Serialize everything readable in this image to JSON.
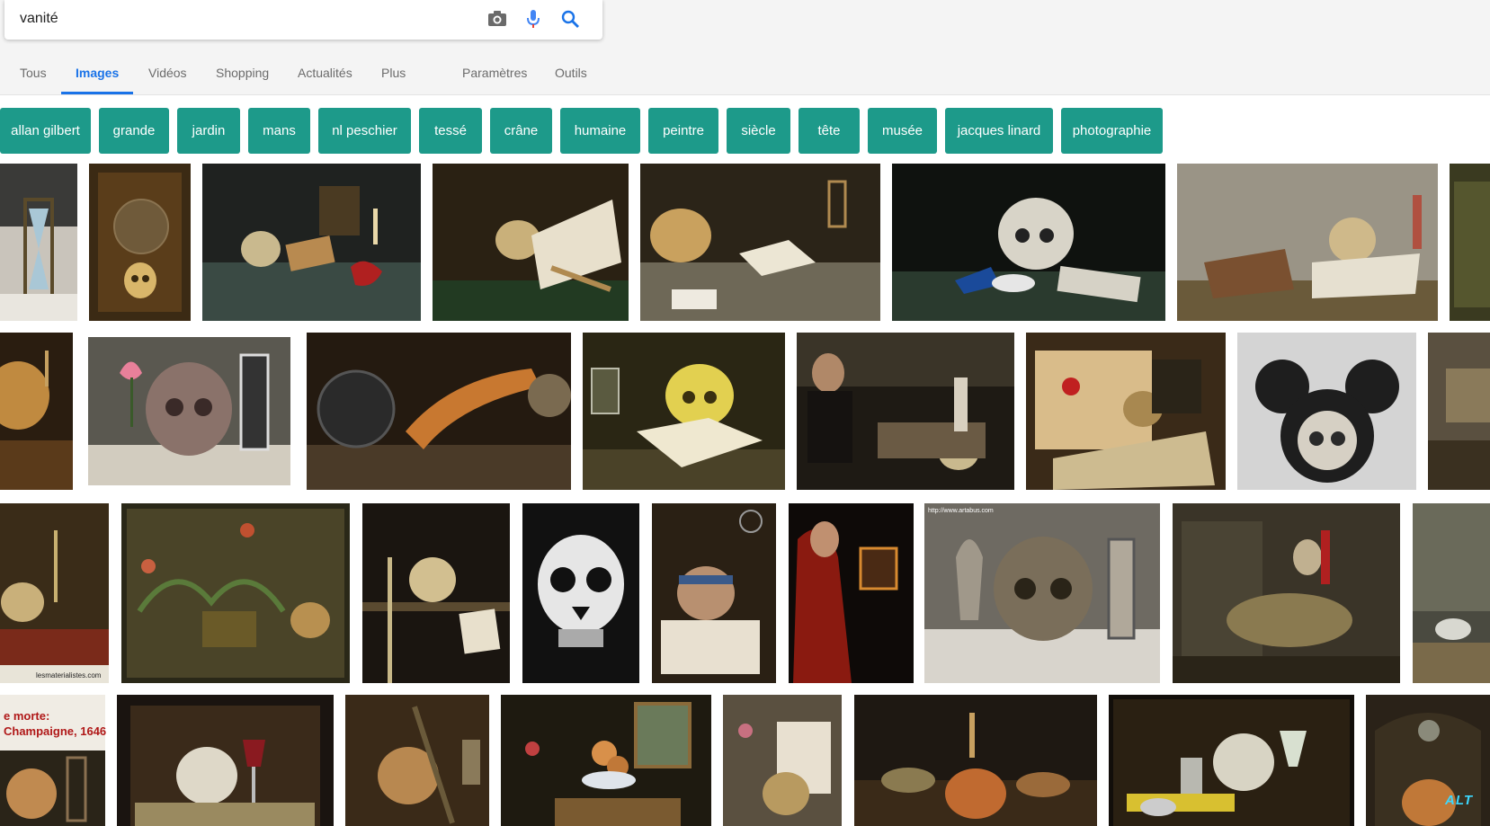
{
  "search": {
    "query": "vanité"
  },
  "icons": {
    "camera": "camera-icon",
    "mic": "microphone-icon",
    "search": "search-icon"
  },
  "tabs": [
    {
      "label": "Tous"
    },
    {
      "label": "Images",
      "active": true
    },
    {
      "label": "Vidéos"
    },
    {
      "label": "Shopping"
    },
    {
      "label": "Actualités"
    },
    {
      "label": "Plus"
    },
    {
      "label": "Paramètres"
    },
    {
      "label": "Outils"
    }
  ],
  "chips": [
    {
      "label": "allan gilbert"
    },
    {
      "label": "grande"
    },
    {
      "label": "jardin"
    },
    {
      "label": "mans"
    },
    {
      "label": "nl peschier"
    },
    {
      "label": "tessé"
    },
    {
      "label": "crâne"
    },
    {
      "label": "humaine"
    },
    {
      "label": "peintre"
    },
    {
      "label": "siècle"
    },
    {
      "label": "tête"
    },
    {
      "label": "musée"
    },
    {
      "label": "jacques linard"
    },
    {
      "label": "photographie"
    }
  ],
  "colors": {
    "accent": "#1a73e8",
    "chip": "#1d9a8a",
    "mic_blue": "#4285f4",
    "mic_red": "#ea4335"
  },
  "thumbs": {
    "caption": "e morte:\nChampaigne, 1646",
    "watermark": "lesmaterialistes.com",
    "url_text": "http://www.artabus.com"
  },
  "corner_logo": "ALT"
}
